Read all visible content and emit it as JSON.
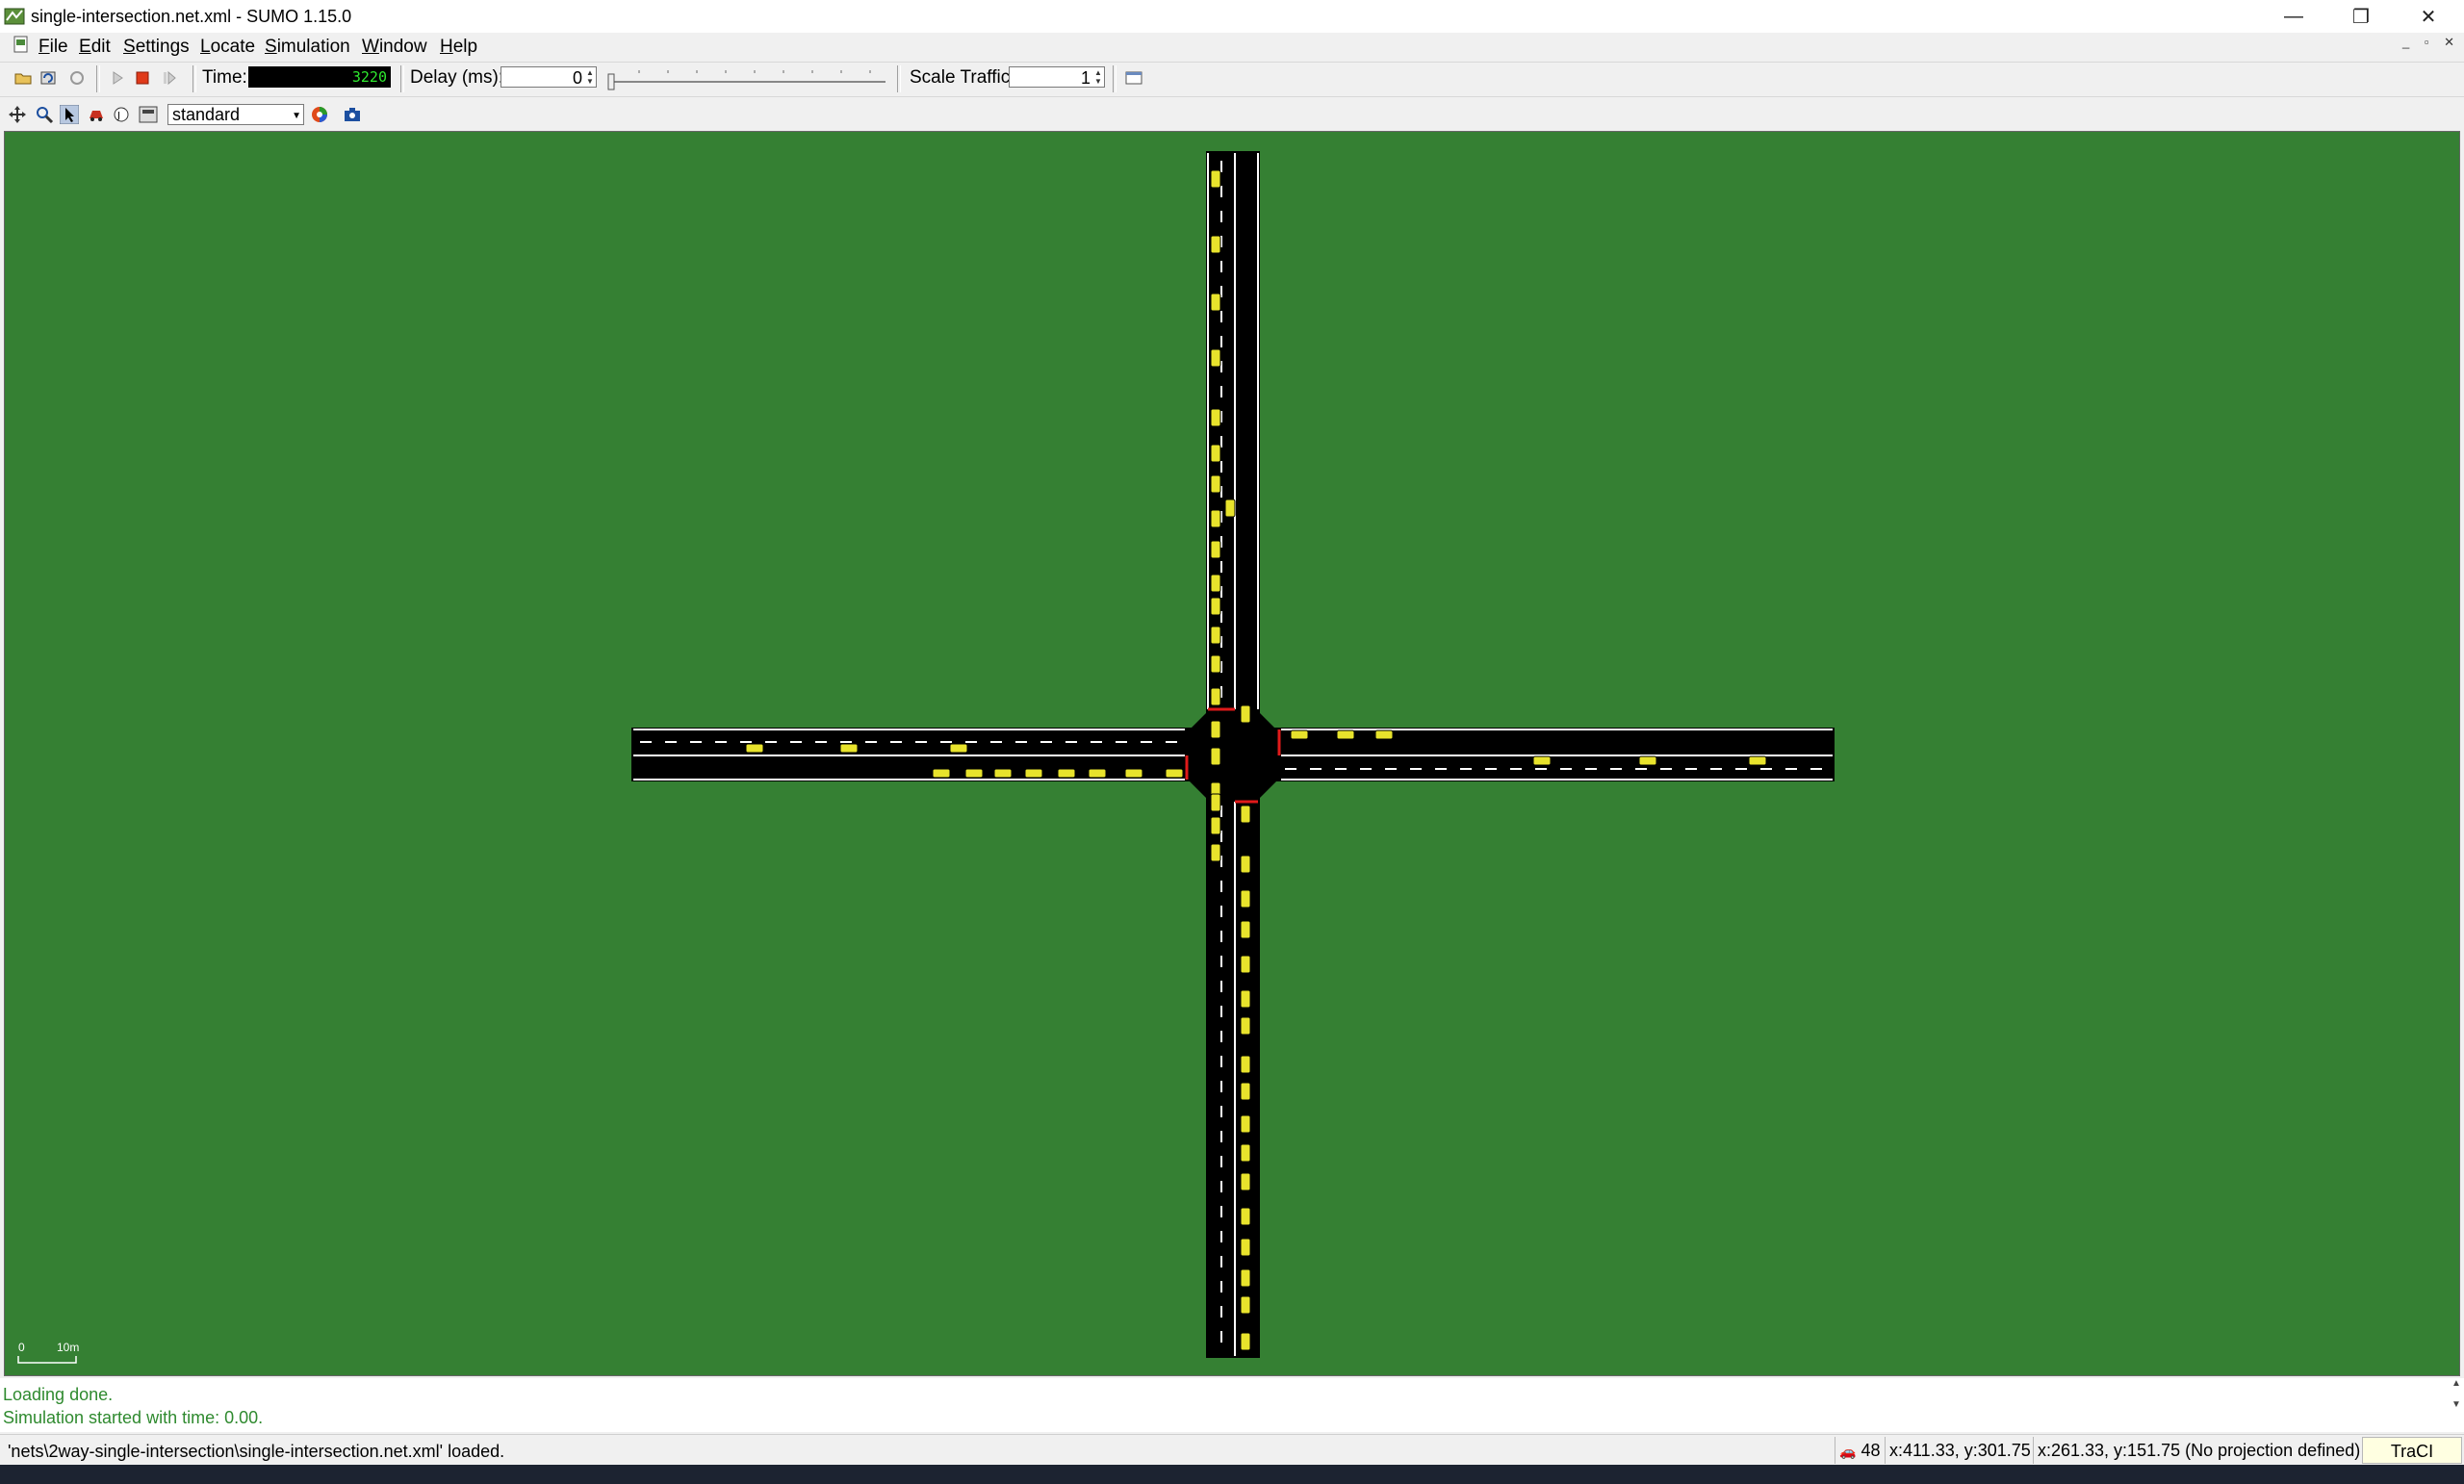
{
  "window": {
    "title": "single-intersection.net.xml - SUMO 1.15.0",
    "controls": {
      "minimize": "—",
      "maximize": "❐",
      "close": "✕"
    }
  },
  "menu": {
    "items": [
      {
        "label": "File"
      },
      {
        "label": "Edit"
      },
      {
        "label": "Settings"
      },
      {
        "label": "Locate"
      },
      {
        "label": "Simulation"
      },
      {
        "label": "Window"
      },
      {
        "label": "Help"
      }
    ],
    "mdi_controls": "_ ▫ ✕"
  },
  "toolbar1": {
    "time_label": "Time:",
    "time_value": "3220",
    "delay_label": "Delay (ms):",
    "delay_value": "0",
    "scale_traffic_label": "Scale Traffic:",
    "scale_traffic_value": "1"
  },
  "toolbar2": {
    "scheme_selected": "standard"
  },
  "view": {
    "background_color": "#358033",
    "road_color": "#000000",
    "vehicle_color": "#e8e32c",
    "scale_bar": {
      "zero_label": "0",
      "length_label": "10m"
    }
  },
  "messages": {
    "lines": [
      "Loading done.",
      "Simulation started with time: 0.00."
    ],
    "color": "#2f8a2f"
  },
  "statusbar": {
    "text": "'nets\\2way-single-intersection\\single-intersection.net.xml' loaded.",
    "vehicle_count": "48",
    "coords_a": "x:411.33, y:301.75",
    "coords_b": "x:261.33, y:151.75 (No projection defined)",
    "traci": "TraCI"
  }
}
